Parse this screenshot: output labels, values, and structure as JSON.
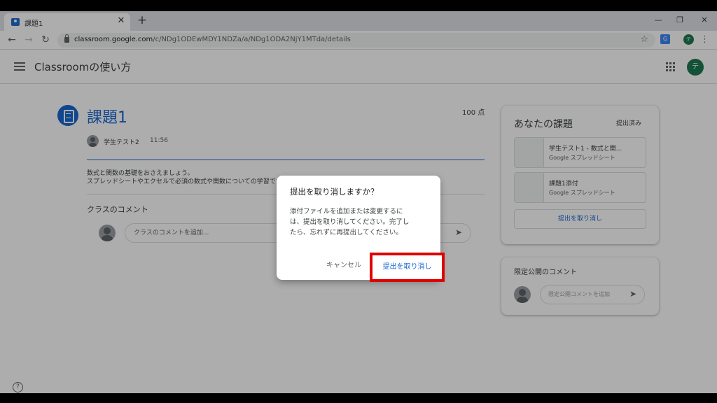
{
  "browser": {
    "tab_title": "課題1",
    "url_host": "classroom.google.com",
    "url_path": "/c/NDg1ODEwMDY1NDZa/a/NDg1ODA2NjY1MTda/details",
    "profile_initial": "テ"
  },
  "header": {
    "app_title": "Classroomの使い方",
    "avatar_initial": "テ"
  },
  "assignment": {
    "title": "課題1",
    "points": "100 点",
    "author": "学生テスト2",
    "time": "11:56",
    "description_line1": "数式と関数の基礎をおさえましょう。",
    "description_line2": "スプレッドシートやエクセルで必須の数式や関数についての学習です。",
    "class_comments_label": "クラスのコメント",
    "class_comment_placeholder": "クラスのコメントを追加..."
  },
  "your_work": {
    "title": "あなたの課題",
    "status": "提出済み",
    "attachments": [
      {
        "name": "学生テスト1 - 数式と関...",
        "type": "Google スプレッドシート"
      },
      {
        "name": "課題1添付",
        "type": "Google スプレッドシート"
      }
    ],
    "unsubmit_label": "提出を取り消し"
  },
  "private_comments": {
    "title": "限定公開のコメント",
    "placeholder": "限定公開コメントを追加"
  },
  "dialog": {
    "title": "提出を取り消しますか？",
    "body_line1": "添付ファイルを追加または変更するに",
    "body_line2": "は、提出を取り消してください。完了し",
    "body_line3": "たら、忘れずに再提出してください。",
    "cancel_label": "キャンセル",
    "confirm_label": "提出を取り消し"
  },
  "colors": {
    "accent_blue": "#1967d2",
    "highlight_red": "#e00000",
    "avatar_green": "#1e7a52"
  }
}
